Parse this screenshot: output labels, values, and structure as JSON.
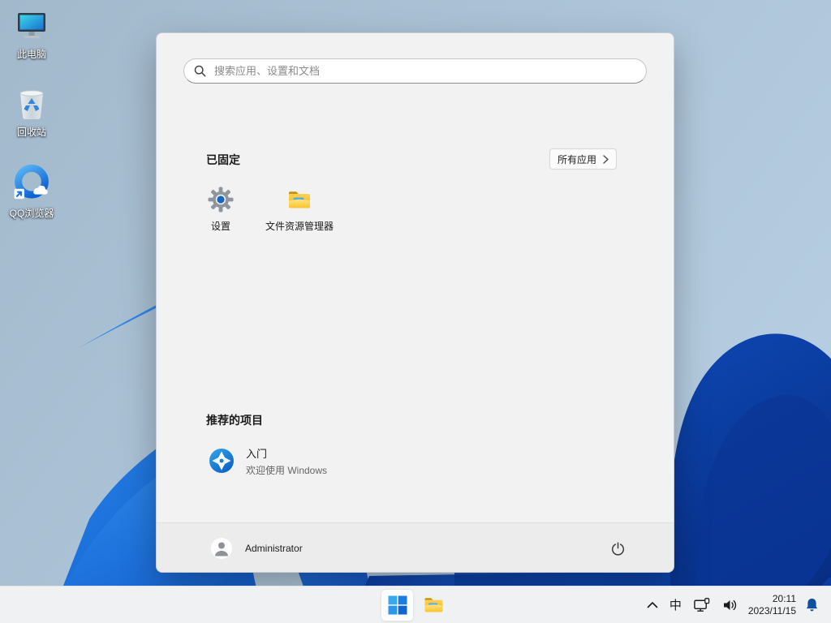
{
  "desktop": {
    "icons": [
      {
        "id": "this-pc",
        "label": "此电脑"
      },
      {
        "id": "recycle-bin",
        "label": "回收站"
      },
      {
        "id": "qq-browser",
        "label": "QQ浏览器"
      }
    ]
  },
  "start_menu": {
    "search_placeholder": "搜索应用、设置和文档",
    "pinned_header": "已固定",
    "all_apps_label": "所有应用",
    "pinned_apps": [
      {
        "label": "设置"
      },
      {
        "label": "文件资源管理器"
      }
    ],
    "recommended_header": "推荐的项目",
    "recommended": [
      {
        "title": "入门",
        "subtitle": "欢迎使用 Windows"
      }
    ],
    "user_name": "Administrator"
  },
  "taskbar": {
    "ime_label": "中",
    "clock": {
      "time": "20:11",
      "date": "2023/11/15"
    }
  },
  "colors": {
    "accent_blue": "#0f6cd6",
    "bell_blue": "#10509e",
    "menu_bg": "#f2f2f2",
    "taskbar_bg": "#eff1f2",
    "wallpaper_sky": "#a9bfd3",
    "bloom_bright": "#1f74dd",
    "bloom_dark": "#0a3a96"
  }
}
